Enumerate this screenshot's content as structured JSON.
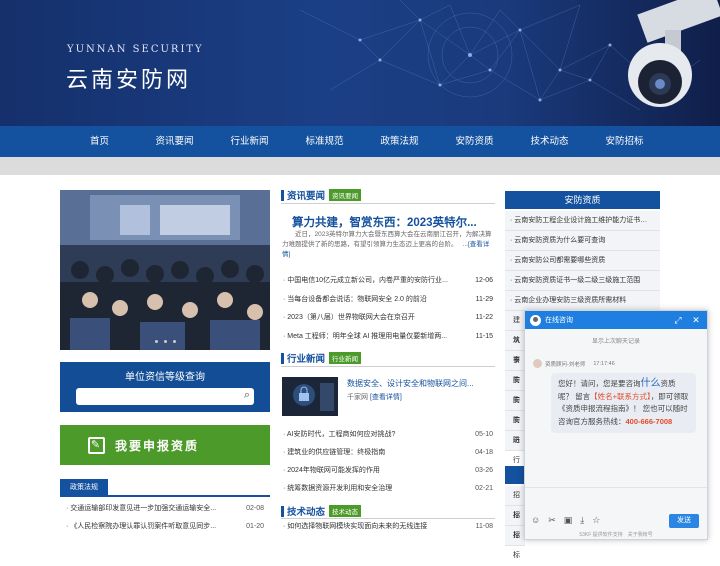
{
  "header": {
    "logo_en": "YUNNAN SECURITY",
    "logo_cn": "云南安防网"
  },
  "nav": [
    "首页",
    "资讯要闻",
    "行业新闻",
    "标准规范",
    "政策法规",
    "安防资质",
    "技术动态",
    "安防招标"
  ],
  "qualification_search": {
    "title": "单位资信等级查询",
    "search_icon": "search-icon"
  },
  "apply": {
    "label": "我要申报资质",
    "icon": "edit-icon"
  },
  "policy": {
    "tab": "政策法规",
    "items": [
      {
        "title": "交通运输部印发意见进一步加强交通运输安全...",
        "date": "02-08"
      },
      {
        "title": "《人民检察院办理认罪认罚案件听取意见同步...",
        "date": "01-20"
      }
    ]
  },
  "news": {
    "section_title": "资讯要闻",
    "tag": "资讯要闻",
    "headline": "算力共建，智赏东西：2023英特尔...",
    "lead": "近日，2023英特尔算力大会暨东西算大会在云南丽江召开，为解决算力难题提供了新的思路，有望引领算力生态迈上更高的台阶。　 ...",
    "lead_link": "[查看详情]",
    "items": [
      {
        "title": "中国电信10亿元成立新公司，内卷严重的安防行业...",
        "date": "12-06"
      },
      {
        "title": "当每台设备都会说话：物联网安全 2.0 的前沿",
        "date": "11-29"
      },
      {
        "title": "2023（第八届）世界物联网大会在京召开",
        "date": "11-22"
      },
      {
        "title": "Meta 工程师：明年全球 AI 推理用电量仅要新增两...",
        "date": "11-15"
      }
    ]
  },
  "industry": {
    "section_title": "行业新闻",
    "tag": "行业新闻",
    "feature_title": "数据安全、设计安全和物联网之间...",
    "feature_source": "千家网",
    "feature_link": "[查看详情]",
    "items": [
      {
        "title": "AI安防时代，工程商如何应对挑战?",
        "date": "05-10"
      },
      {
        "title": "建筑业的供应链管理：终极指南",
        "date": "04-18"
      },
      {
        "title": "2024年物联网可能发挥的作用",
        "date": "03-26"
      },
      {
        "title": "统筹数据资源开发利用和安全治理",
        "date": "02-21"
      }
    ]
  },
  "tech": {
    "section_title": "技术动态",
    "tag": "技术动态",
    "items": [
      {
        "title": "如何选择物联网模块实现面向未来的无线连接",
        "date": "11-08"
      }
    ]
  },
  "sidebar": {
    "title": "安防资质",
    "items": [
      "云南安防工程企业设计施工维护能力证书三...",
      "云南安防资质为什么要可查询",
      "云南安防公司都需要哪些资质",
      "云南安防资质证书一级二级三级施工范围",
      "云南企业办理安防三级资质所需材料"
    ],
    "stubs": [
      "建筑",
      "从事",
      "安防",
      "安防",
      "安防",
      "安防",
      "进行"
    ],
    "stubs2": [
      "招标",
      "招标",
      "招标"
    ]
  },
  "chat": {
    "title": "在线咨询",
    "prev": "显示上次聊天记录",
    "agent": "资质顾问-刘老师",
    "time": "17:17:46",
    "msg_a": "您好！请问，您是要咨询",
    "msg_big": "什么",
    "msg_b": "资质呢？ 留言",
    "msg_c": "【姓名+联系方式】",
    "msg_d": "，即可领取《资质申报流程指南》！ 您也可以随时咨询官方服务热线：",
    "phone": "400-666-7008",
    "send": "发送",
    "footer": "53KF 提供软件支持　关于我帐号"
  },
  "colors": {
    "primary": "#14519e",
    "green": "#4c9a2a",
    "chat_blue": "#1e7fe0",
    "phone_red": "#e24b2a"
  }
}
